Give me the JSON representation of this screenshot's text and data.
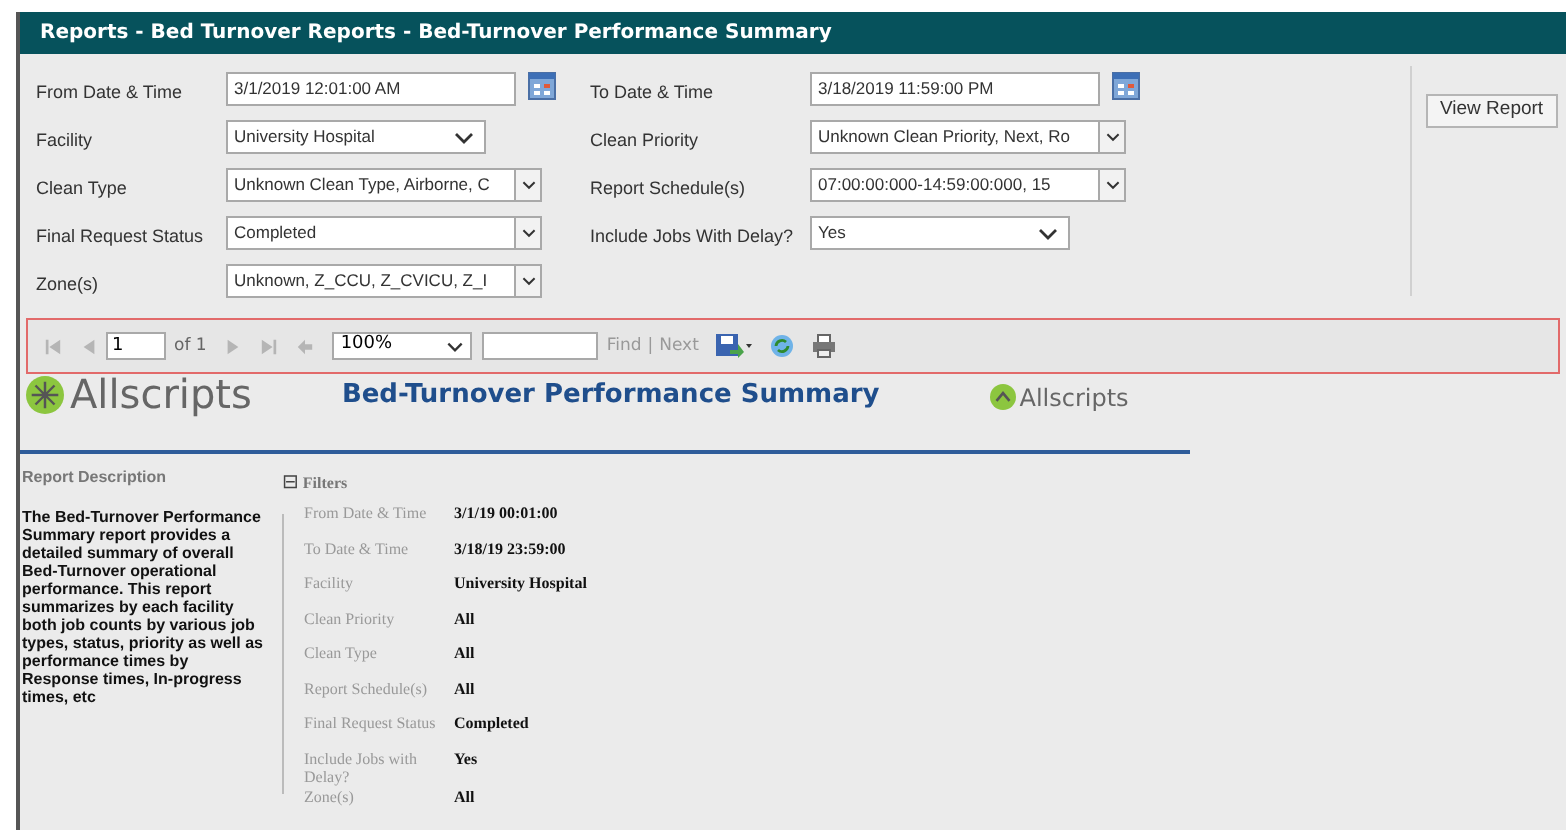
{
  "window": {
    "title": "Reports - Bed Turnover Reports - Bed-Turnover Performance Summary"
  },
  "parameters_left": [
    {
      "label": "From Date & Time",
      "kind": "date",
      "value": "3/1/2019 12:01:00 AM"
    },
    {
      "label": "Facility",
      "kind": "select",
      "value": "University Hospital"
    },
    {
      "label": "Clean Type",
      "kind": "multiselect",
      "value": "Unknown Clean Type, Airborne, C"
    },
    {
      "label": "Final Request Status",
      "kind": "multiselect",
      "value": "Completed"
    },
    {
      "label": "Zone(s)",
      "kind": "multiselect",
      "value": "Unknown, Z_CCU, Z_CVICU, Z_I"
    }
  ],
  "parameters_right": [
    {
      "label": "To Date & Time",
      "kind": "date",
      "value": "3/18/2019 11:59:00 PM"
    },
    {
      "label": "Clean Priority",
      "kind": "multiselect",
      "value": "Unknown Clean Priority, Next, Ro"
    },
    {
      "label": "Report Schedule(s)",
      "kind": "multiselect",
      "value": "07:00:00:000-14:59:00:000, 15"
    },
    {
      "label": "Include Jobs With Delay?",
      "kind": "select",
      "value": "Yes"
    }
  ],
  "view_report_button": "View Report",
  "toolbar": {
    "page": "1",
    "page_count": "of 1",
    "zoom": "100%",
    "find": "Find",
    "separator": "|",
    "next": "Next",
    "nav_disabled": true
  },
  "report": {
    "logo_left": "Allscripts",
    "title": "Bed-Turnover Performance Summary",
    "logo_right": "Allscripts",
    "description_heading": "Report Description",
    "description": "The Bed-Turnover Performance Summary report provides a detailed summary of overall Bed-Turnover operational performance. This report summarizes by each facility both job counts by various job types, status, priority as well as performance times by Response times, In-progress times, etc",
    "filters_toggle": "⊟",
    "filters_heading": "Filters",
    "filters_expanded": true,
    "filters": [
      {
        "label": "From Date & Time",
        "value": "3/1/19 00:01:00"
      },
      {
        "label": "To Date & Time",
        "value": "3/18/19 23:59:00"
      },
      {
        "label": "Facility",
        "value": "University Hospital"
      },
      {
        "label": "Clean Priority",
        "value": "All"
      },
      {
        "label": "Clean Type",
        "value": "All"
      },
      {
        "label": "Report Schedule(s)",
        "value": "All"
      },
      {
        "label": "Final Request Status",
        "value": "Completed"
      },
      {
        "label": "Include Jobs with Delay?",
        "value": "Yes"
      },
      {
        "label": "Zone(s)",
        "value": "All"
      }
    ]
  }
}
